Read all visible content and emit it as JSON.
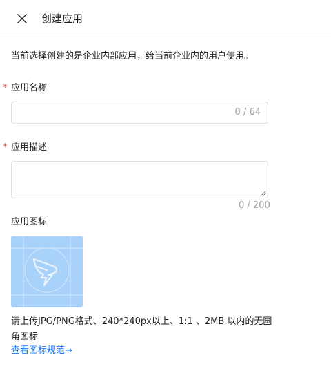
{
  "header": {
    "title": "创建应用",
    "close_icon": "close-icon"
  },
  "intro_text": "当前选择创建的是企业内部应用，给当前企业内的用户使用。",
  "form": {
    "required_mark": "*",
    "name": {
      "label": "应用名称",
      "value": "",
      "counter": "0 / 64"
    },
    "description": {
      "label": "应用描述",
      "value": "",
      "counter": "0 / 200"
    },
    "icon": {
      "label": "应用图标",
      "icon_name": "dingtalk-logo-icon",
      "hint": "请上传JPG/PNG格式、240*240px以上、1:1 、2MB 以内的无圆角图标",
      "link_text": "查看图标规范",
      "link_arrow": "→"
    }
  },
  "colors": {
    "required": "#f04134",
    "link": "#1677ff",
    "icon_tile": "#a9d2fb",
    "border": "#dcdfe4",
    "counter": "#9aa0a8"
  }
}
